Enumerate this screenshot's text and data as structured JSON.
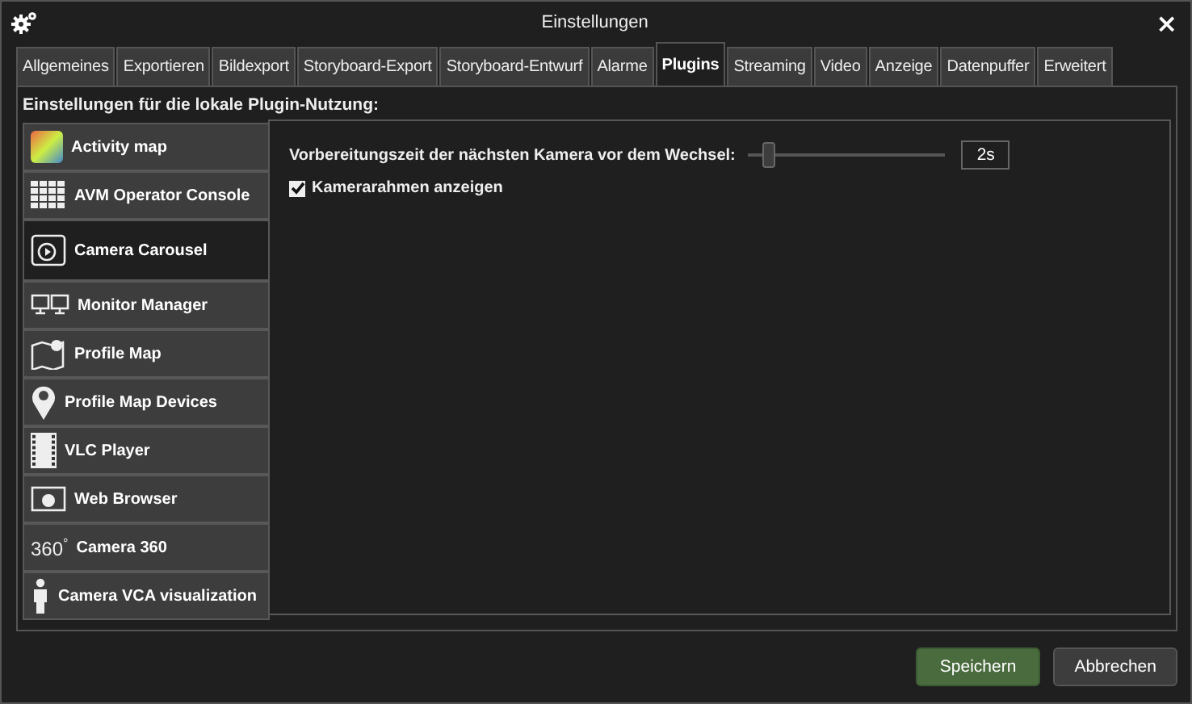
{
  "window": {
    "title": "Einstellungen",
    "close": "×"
  },
  "tabs": [
    {
      "label": "Allgemeines",
      "selected": false
    },
    {
      "label": "Exportieren",
      "selected": false
    },
    {
      "label": "Bildexport",
      "selected": false
    },
    {
      "label": "Storyboard-Export",
      "selected": false
    },
    {
      "label": "Storyboard-Entwurf",
      "selected": false
    },
    {
      "label": "Alarme",
      "selected": false
    },
    {
      "label": "Plugins",
      "selected": true
    },
    {
      "label": "Streaming",
      "selected": false
    },
    {
      "label": "Video",
      "selected": false
    },
    {
      "label": "Anzeige",
      "selected": false
    },
    {
      "label": "Datenpuffer",
      "selected": false
    },
    {
      "label": "Erweitert",
      "selected": false
    }
  ],
  "section_title": "Einstellungen für die lokale Plugin-Nutzung:",
  "plugins": [
    {
      "label": "Activity map",
      "selected": false
    },
    {
      "label": "AVM Operator Console",
      "selected": false
    },
    {
      "label": "Camera Carousel",
      "selected": true
    },
    {
      "label": "Monitor Manager",
      "selected": false
    },
    {
      "label": "Profile Map",
      "selected": false
    },
    {
      "label": "Profile Map Devices",
      "selected": false
    },
    {
      "label": "VLC Player",
      "selected": false
    },
    {
      "label": "Web Browser",
      "selected": false
    },
    {
      "label": "Camera 360",
      "selected": false,
      "icon_text": "360$^{°}$"
    },
    {
      "label": "Camera VCA visualization",
      "selected": false
    }
  ],
  "settings": {
    "slider": {
      "label": "Vorbereitungszeit der nächsten Kamera vor dem Wechsel:",
      "level": 0.1,
      "value": "2s"
    },
    "checkbox": {
      "label": "Kamerarahmen anzeigen",
      "checked": true
    }
  },
  "buttons": [
    {
      "label": "Speichern",
      "kind": "primary"
    },
    {
      "label": "Abbrechen",
      "kind": "secondary"
    }
  ]
}
